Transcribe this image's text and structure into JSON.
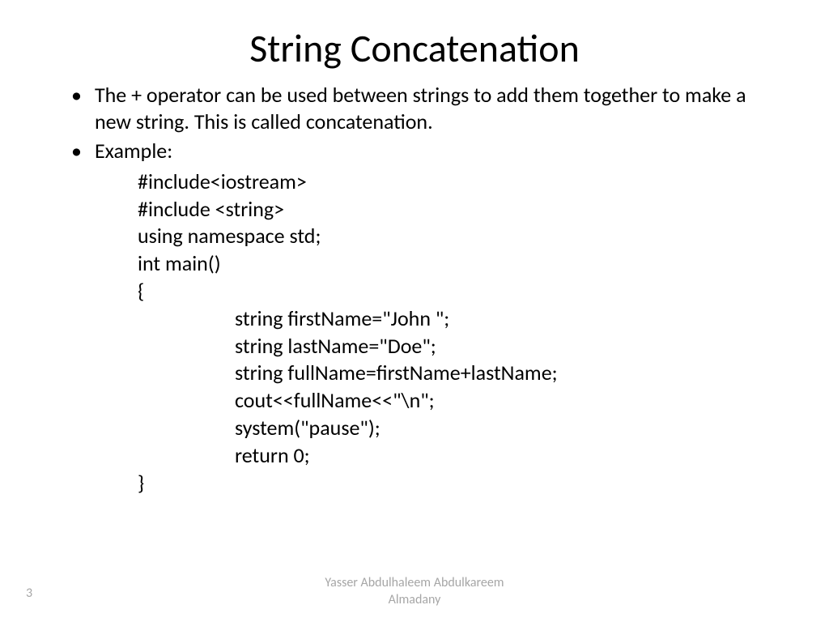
{
  "title": "String Concatenation",
  "bullets": [
    "The + operator can be used between strings to add them together to make a new string. This is called concatenation.",
    "Example:"
  ],
  "code": {
    "line1": "#include<iostream>",
    "line2": "#include <string>",
    "line3": "using namespace std;",
    "line4": "int main()",
    "line5": "{",
    "line6": "string firstName=\"John \";",
    "line7": "string lastName=\"Doe\";",
    "line8": "string fullName=firstName+lastName;",
    "line9": "cout<<fullName<<\"\\n\";",
    "line10": "system(\"pause\");",
    "line11": "return 0;",
    "line12": "}"
  },
  "footer": {
    "pageNumber": "3",
    "author": "Yasser Abdulhaleem Abdulkareem Almadany"
  }
}
